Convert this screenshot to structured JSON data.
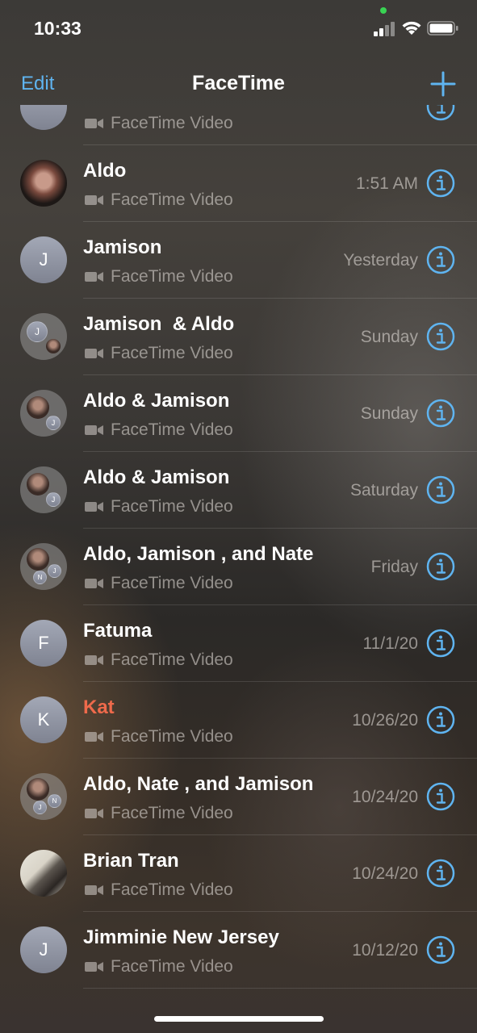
{
  "status_bar": {
    "time": "10:33",
    "icons": [
      "cellular-signal-icon",
      "wifi-icon",
      "battery-icon"
    ]
  },
  "nav": {
    "edit_label": "Edit",
    "title": "FaceTime",
    "add_icon": "plus-icon"
  },
  "colors": {
    "accent": "#5fb4f0",
    "missed": "#ef6a4b"
  },
  "calls": [
    {
      "name": "",
      "subtitle": "FaceTime Video",
      "date": "",
      "avatar": "letter",
      "initial": ""
    },
    {
      "name": "Aldo",
      "subtitle": "FaceTime Video",
      "date": "1:51 AM",
      "avatar": "photo"
    },
    {
      "name": "Jamison",
      "subtitle": "FaceTime Video",
      "date": "Yesterday",
      "avatar": "letter",
      "initial": "J"
    },
    {
      "name": "Jamison  & Aldo",
      "subtitle": "FaceTime Video",
      "date": "Sunday",
      "avatar": "group"
    },
    {
      "name": "Aldo & Jamison",
      "subtitle": "FaceTime Video",
      "date": "Sunday",
      "avatar": "group"
    },
    {
      "name": "Aldo & Jamison",
      "subtitle": "FaceTime Video",
      "date": "Saturday",
      "avatar": "group"
    },
    {
      "name": "Aldo, Jamison , and Nate",
      "subtitle": "FaceTime Video",
      "date": "Friday",
      "avatar": "group"
    },
    {
      "name": "Fatuma",
      "subtitle": "FaceTime Video",
      "date": "11/1/20",
      "avatar": "letter",
      "initial": "F"
    },
    {
      "name": "Kat",
      "subtitle": "FaceTime Video",
      "date": "10/26/20",
      "avatar": "letter",
      "initial": "K",
      "missed": true
    },
    {
      "name": "Aldo, Nate , and Jamison",
      "subtitle": "FaceTime Video",
      "date": "10/24/20",
      "avatar": "group"
    },
    {
      "name": "Brian Tran",
      "subtitle": "FaceTime Video",
      "date": "10/24/20",
      "avatar": "photo"
    },
    {
      "name": "Jimminie New Jersey",
      "subtitle": "FaceTime Video",
      "date": "10/12/20",
      "avatar": "letter",
      "initial": "J"
    }
  ],
  "group_avatars": {
    "row3": [
      "J",
      ""
    ],
    "row4": [
      "",
      "J"
    ],
    "row5": [
      "",
      "J"
    ],
    "row6": [
      "",
      "N",
      "J"
    ],
    "row9": [
      "",
      "J",
      "N"
    ]
  }
}
